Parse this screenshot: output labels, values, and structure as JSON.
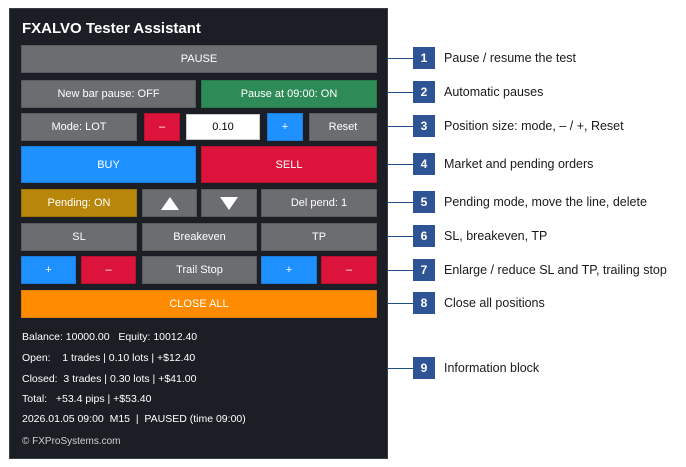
{
  "panel": {
    "title": "FXALVO Tester Assistant",
    "pause_label": "PAUSE",
    "new_bar_pause_label": "New bar pause: OFF",
    "pause_at_label": "Pause at 09:00: ON",
    "mode_label": "Mode: LOT",
    "minus_label": "–",
    "lot_value": "0.10",
    "plus_label": "+",
    "reset_label": "Reset",
    "buy_label": "BUY",
    "sell_label": "SELL",
    "pending_label": "Pending: ON",
    "del_pend_label": "Del pend: 1",
    "sl_label": "SL",
    "breakeven_label": "Breakeven",
    "tp_label": "TP",
    "sl_plus_label": "+",
    "sl_minus_label": "–",
    "trail_stop_label": "Trail Stop",
    "tp_plus_label": "+",
    "tp_minus_label": "–",
    "close_all_label": "CLOSE ALL",
    "info": {
      "balance": "Balance: 10000.00   Equity: 10012.40",
      "open": "Open:    1 trades | 0.10 lots | +$12.40",
      "closed": "Closed:  3 trades | 0.30 lots | +$41.00",
      "total": "Total:   +53.4 pips | +$53.40",
      "status": "2026.01.05 09:00  M15  |  PAUSED (time 09:00)"
    },
    "copyright": "© FXProSystems.com"
  },
  "callouts": [
    {
      "number": "1",
      "text": "Pause / resume the test"
    },
    {
      "number": "2",
      "text": "Automatic pauses"
    },
    {
      "number": "3",
      "text": "Position size: mode, – / +, Reset"
    },
    {
      "number": "4",
      "text": "Market and pending orders"
    },
    {
      "number": "5",
      "text": "Pending mode, move the line, delete"
    },
    {
      "number": "6",
      "text": "SL, breakeven, TP"
    },
    {
      "number": "7",
      "text": "Enlarge / reduce SL and TP, trailing stop"
    },
    {
      "number": "8",
      "text": "Close all positions"
    },
    {
      "number": "9",
      "text": "Information block"
    }
  ],
  "colors": {
    "panel_bg": "#1b1e24",
    "grey": "#6b6d70",
    "red": "#dc143c",
    "blue": "#1e90ff",
    "green": "#2e8b57",
    "gold": "#b8860b",
    "orange": "#ff8c00",
    "badge": "#2f5496"
  }
}
